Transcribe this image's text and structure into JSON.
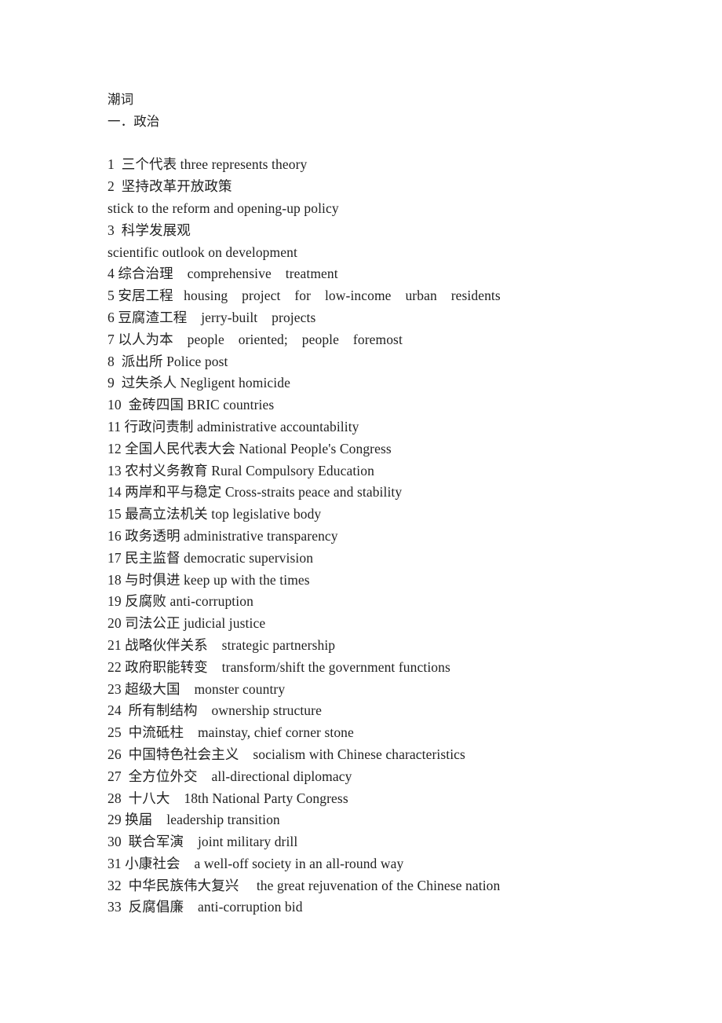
{
  "document": {
    "title": "潮词",
    "section_heading": "一．政治",
    "entries": [
      {
        "n": "1",
        "line": "1  三个代表 three represents theory"
      },
      {
        "n": "2",
        "line": "2  坚持改革开放政策"
      },
      {
        "n": "2b",
        "line": "stick to the reform and opening-up policy"
      },
      {
        "n": "3",
        "line": "3  科学发展观"
      },
      {
        "n": "3b",
        "line": "scientific outlook on development"
      },
      {
        "n": "4",
        "line": "4 综合治理    comprehensive    treatment"
      },
      {
        "n": "5",
        "line": "5 安居工程   housing    project    for    low-income    urban    residents"
      },
      {
        "n": "6",
        "line": "6 豆腐渣工程    jerry-built    projects"
      },
      {
        "n": "7",
        "line": "7 以人为本    people    oriented;    people    foremost"
      },
      {
        "n": "8",
        "line": "8  派出所 Police post"
      },
      {
        "n": "9",
        "line": "9  过失杀人 Negligent homicide"
      },
      {
        "n": "10",
        "line": "10  金砖四国 BRIC countries"
      },
      {
        "n": "11",
        "line": "11 行政问责制 administrative accountability"
      },
      {
        "n": "12",
        "line": "12 全国人民代表大会 National People's Congress"
      },
      {
        "n": "13",
        "line": "13 农村义务教育 Rural Compulsory Education"
      },
      {
        "n": "14",
        "line": "14 两岸和平与稳定 Cross-straits peace and stability"
      },
      {
        "n": "15",
        "line": "15 最高立法机关 top legislative body"
      },
      {
        "n": "16",
        "line": "16 政务透明 administrative transparency"
      },
      {
        "n": "17",
        "line": "17 民主监督 democratic supervision"
      },
      {
        "n": "18",
        "line": "18 与时俱进 keep up with the times"
      },
      {
        "n": "19",
        "line": "19 反腐败 anti-corruption"
      },
      {
        "n": "20",
        "line": "20 司法公正 judicial justice"
      },
      {
        "n": "21",
        "line": "21 战略伙伴关系    strategic partnership"
      },
      {
        "n": "22",
        "line": "22 政府职能转变    transform/shift the government functions"
      },
      {
        "n": "23",
        "line": "23 超级大国    monster country"
      },
      {
        "n": "24",
        "line": "24  所有制结构    ownership structure"
      },
      {
        "n": "25",
        "line": "25  中流砥柱    mainstay, chief corner stone"
      },
      {
        "n": "26",
        "line": "26  中国特色社会主义    socialism with Chinese characteristics"
      },
      {
        "n": "27",
        "line": "27  全方位外交    all-directional diplomacy"
      },
      {
        "n": "28",
        "line": "28  十八大    18th National Party Congress"
      },
      {
        "n": "29",
        "line": "29 换届    leadership transition"
      },
      {
        "n": "30",
        "line": "30  联合军演    joint military drill"
      },
      {
        "n": "31",
        "line": "31 小康社会    a well-off society in an all-round way"
      },
      {
        "n": "32",
        "line": "32  中华民族伟大复兴     the great rejuvenation of the Chinese nation"
      },
      {
        "n": "33",
        "line": "33  反腐倡廉    anti-corruption bid"
      }
    ]
  }
}
